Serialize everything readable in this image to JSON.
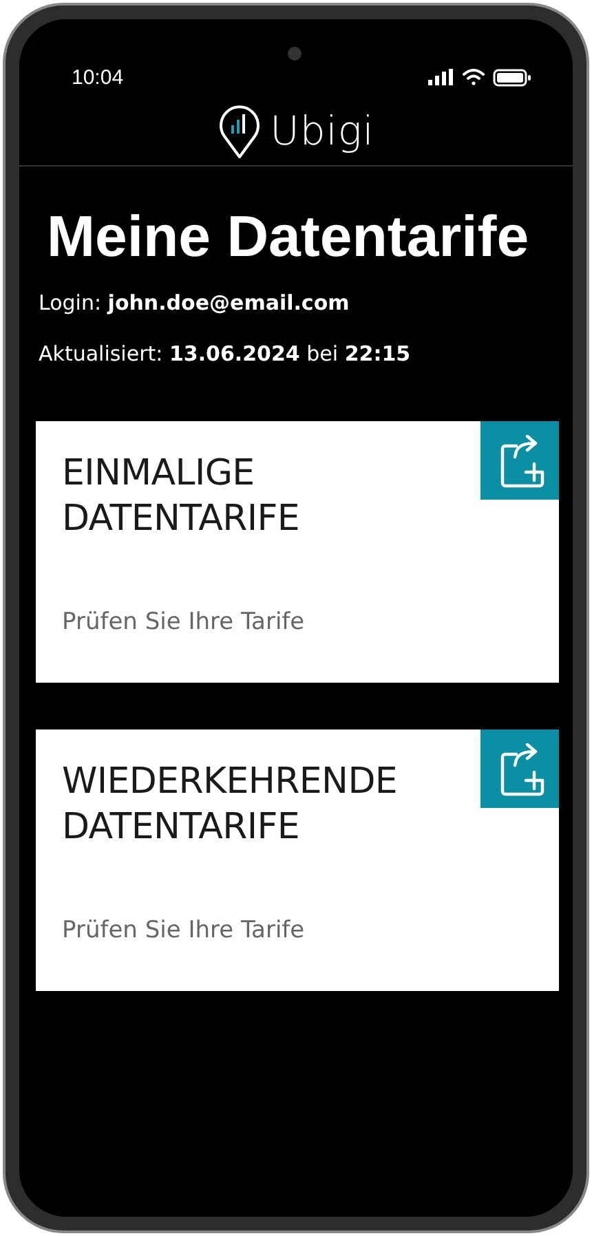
{
  "status_bar": {
    "time": "10:04"
  },
  "header": {
    "logo_text": "Ubigi"
  },
  "page_title": "Meine Datentarife",
  "login": "Login: **john.doe@email.com**",
  "updated": "Aktualisiert: **13.06.2024** bei **22:15**",
  "cards": [
    {
      "title": "EINMALIGE DATENTARIFE",
      "subtitle": "Prüfen Sie Ihre Tarife"
    },
    {
      "title": "WIEDERKEHRENDE DATENTARIFE",
      "subtitle": "Prüfen Sie Ihre Tarife"
    }
  ]
}
